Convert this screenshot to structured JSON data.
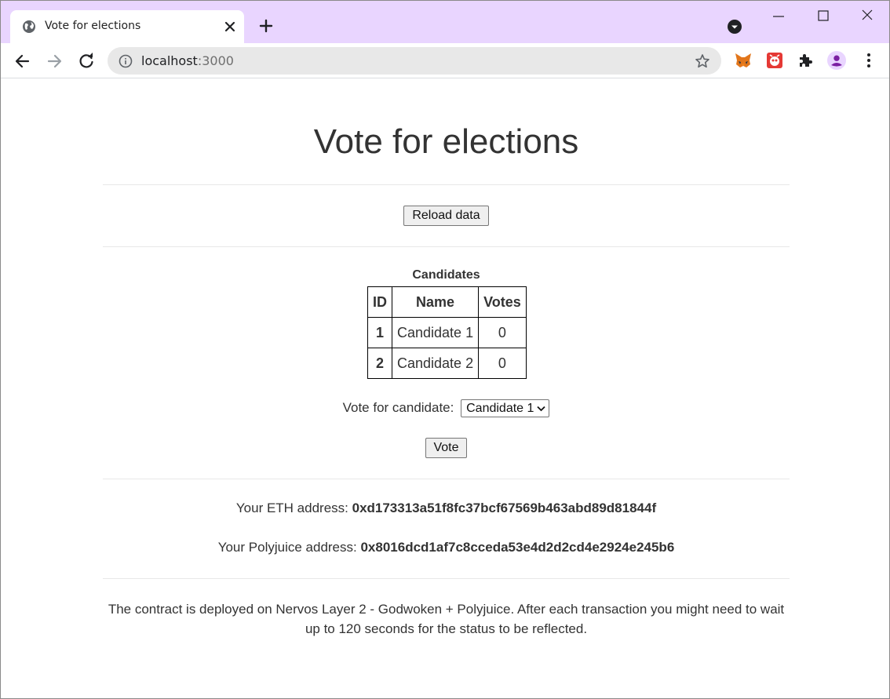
{
  "browser": {
    "tab_title": "Vote for elections",
    "url_host": "localhost",
    "url_port": ":3000"
  },
  "icons": {
    "colors": {
      "tabbar": "#e9d5ff",
      "profile": "#8a2be2",
      "ext_red": "#e53935"
    }
  },
  "page": {
    "title": "Vote for elections",
    "reload_label": "Reload data",
    "table": {
      "caption": "Candidates",
      "headers": [
        "ID",
        "Name",
        "Votes"
      ],
      "rows": [
        {
          "id": "1",
          "name": "Candidate 1",
          "votes": "0"
        },
        {
          "id": "2",
          "name": "Candidate 2",
          "votes": "0"
        }
      ]
    },
    "vote_label": "Vote for candidate:",
    "vote_selected": "Candidate 1",
    "vote_button": "Vote",
    "eth_label": "Your ETH address:",
    "eth_address": "0xd173313a51f8fc37bcf67569b463abd89d81844f",
    "poly_label": "Your Polyjuice address:",
    "poly_address": "0x8016dcd1af7c8cceda53e4d2d2cd4e2924e245b6",
    "footnote": "The contract is deployed on Nervos Layer 2 - Godwoken + Polyjuice. After each transaction you might need to wait up to 120 seconds for the status to be reflected."
  }
}
